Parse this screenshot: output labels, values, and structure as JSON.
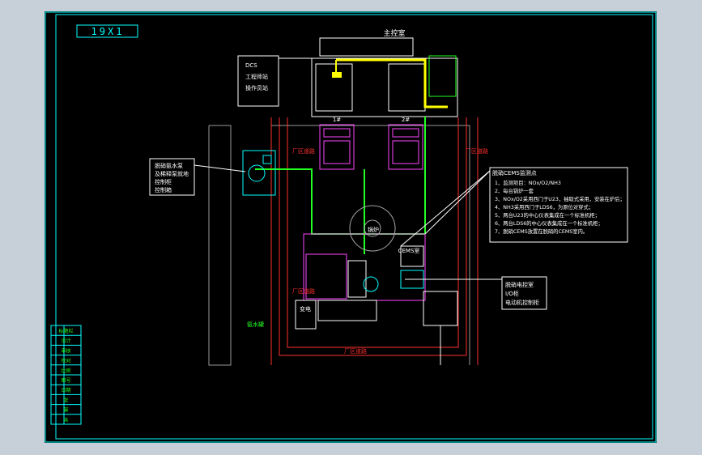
{
  "drawing": {
    "frame_code": "19X1",
    "colors": {
      "background": "#000000",
      "frame": "#00ffff",
      "wall": "#ff3030",
      "duct": "#22ff22",
      "equipment": "#ff44ff",
      "cable": "#ffff00",
      "annotation": "#ffffff"
    }
  },
  "control_room": {
    "title": "主控室"
  },
  "dcs_station": {
    "line1": "DCS",
    "line2": "工程师站",
    "line3": "操作员站"
  },
  "pump_note": {
    "line1": "脱硝氨水泵",
    "line2": "及稀释泵就地",
    "line3": "控制柜",
    "line4": "控制箱"
  },
  "cems_notes": {
    "title": "脱硝CEMS监测点",
    "items": [
      "1、监测项目：NOx/O2/NH3",
      "2、每台锅炉一套",
      "3、NOx/O2采用西门子U23，抽取式采用，安装在炉后；",
      "4、NH3采用西门子LDS6，为原位对穿式；",
      "5、两台U23的中心仪表集成在一个标准机柜；",
      "6、两台LDS6的中心仪表集成在一个标准机柜；",
      "7、脱硝CEMS放置在脱硝的CEMS室内。"
    ]
  },
  "io_cabinet_note": {
    "line1": "脱硝电控室",
    "line2": "I/O柜",
    "line3": "电动机控制柜"
  },
  "small_labels": {
    "wall_a": "厂区道路",
    "wall_b": "厂区道路",
    "wall_c": "厂区道路",
    "wall_d": "厂区道路",
    "tank": "氨水罐",
    "boiler": "锅炉",
    "cems_room": "CEMS室",
    "substation": "变电",
    "unit1": "1#",
    "unit2": "2#"
  },
  "title_block": {
    "rows": [
      "标题栏",
      "设计",
      "审核",
      "校对",
      "比例",
      "图号",
      "日期",
      "张",
      "第",
      "共"
    ]
  }
}
